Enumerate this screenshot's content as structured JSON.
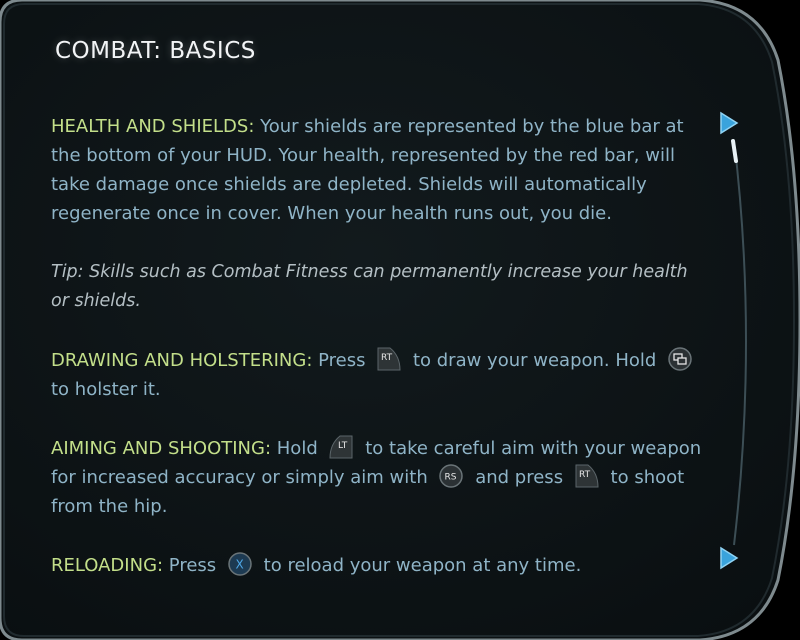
{
  "title": "COMBAT: BASICS",
  "sections": {
    "health": {
      "heading": "HEALTH AND SHIELDS:",
      "text": " Your shields are represented by the blue bar at the bottom of your HUD. Your health, represented by the red bar, will take damage once shields are depleted. Shields will automatically regenerate once in cover. When your health runs out, you die."
    },
    "tip": {
      "text": "Tip: Skills such as Combat Fitness can permanently increase your health or shields."
    },
    "drawing": {
      "heading": "DRAWING AND HOLSTERING:",
      "text1": " Press",
      "text2": "to draw your weapon. Hold",
      "text3": "to holster it."
    },
    "aiming": {
      "heading": "AIMING AND SHOOTING:",
      "text1": " Hold",
      "text2": "to take careful aim with your weapon for increased accuracy or simply aim with",
      "text3": "and press",
      "text4": "to shoot from the hip."
    },
    "reloading": {
      "heading": "RELOADING:",
      "text1": " Press",
      "text2": "to reload your weapon at any time."
    }
  },
  "buttons": {
    "rt": "RT",
    "lt": "LT",
    "rs": "RS",
    "x": "X"
  },
  "colors": {
    "heading": "#c3df8a",
    "body": "#8fb4c7",
    "title": "#f2f4f6",
    "accent": "#3aa3dc"
  },
  "icons": [
    "right-triangle-arrow-icon",
    "back-view-icon"
  ]
}
